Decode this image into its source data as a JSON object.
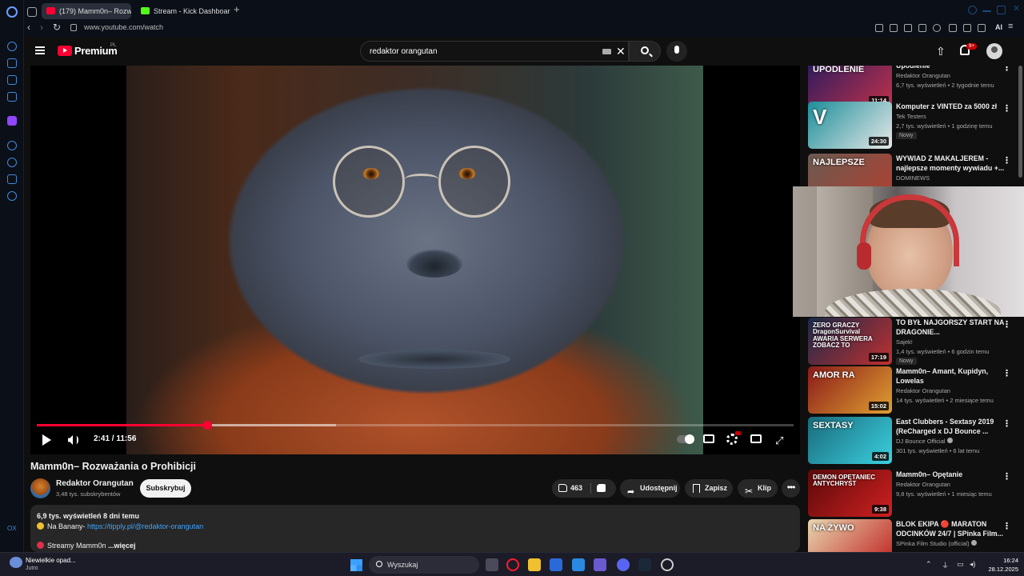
{
  "browser": {
    "tabs": [
      {
        "label": "(179) Mamm0n– Rozważani",
        "active": true
      },
      {
        "label": "Stream - Kick Dashboard",
        "active": false
      }
    ],
    "url": "www.youtube.com/watch",
    "ai_label": "AI"
  },
  "header": {
    "logo_text": "Premium",
    "region": "PL",
    "search_value": "redaktor orangutan",
    "notifications_badge": "9+"
  },
  "player": {
    "time_display": "2:41 / 11:56",
    "progress_fraction": 0.225,
    "buffer_fraction": 0.395
  },
  "video": {
    "title": "Mamm0n– Rozważania o Prohibicji",
    "channel_name": "Redaktor Orangutan",
    "subscribers": "3,48 tys. subskrybentów",
    "subscribe_label": "Subskrybuj",
    "likes": "463",
    "share_label": "Udostępnij",
    "save_label": "Zapisz",
    "clip_label": "Klip",
    "more_label": "•••"
  },
  "description": {
    "meta": "6,9 tys. wyświetleń  8 dni temu",
    "line1_prefix": "Na Banany- ",
    "line1_link": "https://tipply.pl/@redaktor-orangutan",
    "line2_prefix": "Streamy Mamm0n",
    "line2_more": " ...więcej"
  },
  "related": [
    {
      "title": "Upodlenie",
      "channel": "Redaktor Orangutan",
      "meta": "6,7 tys. wyświetleń • 2 tygodnie temu",
      "duration": "11:14",
      "badge": "",
      "thumb_text": "UPODLENIE",
      "color1": "#2d1b5e",
      "color2": "#c0314a"
    },
    {
      "title": "Komputer z VINTED za 5000 zł",
      "channel": "Tek Testers",
      "meta": "2,7 tys. wyświetleń • 1 godzinę temu",
      "duration": "24:30",
      "badge": "Nowy",
      "thumb_text": "V",
      "color1": "#1c8f9a",
      "color2": "#e8e8e8"
    },
    {
      "title": "WYWIAD Z MAKALJEREM - najlepsze momenty wywiadu +...",
      "channel": "DOMINEWS",
      "meta": "",
      "duration": "",
      "badge": "",
      "thumb_text": "NAJLEPSZE",
      "color1": "#6a5a52",
      "color2": "#b04030"
    },
    {
      "title": "TO BYŁ NAJGORSZY START NA DRAGONIE...",
      "channel": "Sajek!",
      "meta": "1,4 tys. wyświetleń • 6 godzin temu",
      "duration": "17:19",
      "badge": "Nowy",
      "thumb_text": "ZERO GRACZY DragonSurvival AWARIA SERWERA ZOBACZ TO",
      "color1": "#1a2a4a",
      "color2": "#c03030"
    },
    {
      "title": "Mamm0n– Amant, Kupidyn, Lowelas",
      "channel": "Redaktor Orangutan",
      "meta": "14 tys. wyświetleń • 2 miesiące temu",
      "duration": "15:02",
      "badge": "",
      "thumb_text": "AMOR RA",
      "color1": "#8a1a1a",
      "color2": "#e0a030"
    },
    {
      "title": "East Clubbers - Sextasy 2019 (ReCharged x DJ Bounce ...",
      "channel": "DJ Bounce Official",
      "meta": "301 tys. wyświetleń • 6 lat temu",
      "duration": "4:02",
      "badge": "",
      "thumb_text": "SEXTASY",
      "color1": "#1a6a7a",
      "color2": "#3ad0e0"
    },
    {
      "title": "Mamm0n– Opętanie",
      "channel": "Redaktor Orangutan",
      "meta": "9,8 tys. wyświetleń • 1 miesiąc temu",
      "duration": "9:38",
      "badge": "",
      "thumb_text": "DEMON OPĘTANIEC ANTYCHRYST",
      "color1": "#5a0a0a",
      "color2": "#d02020"
    },
    {
      "title": "BLOK EKIPA 🔴 MARATON ODCINKÓW 24/7 | SPinka Film...",
      "channel": "SPinka Film Studio (official)",
      "meta": "",
      "duration": "",
      "badge": "",
      "thumb_text": "NA ŻYWO",
      "color1": "#e8d8b0",
      "color2": "#c02020"
    }
  ],
  "taskbar": {
    "weather_title": "Niewielkie opad...",
    "weather_sub": "Jutro",
    "search_placeholder": "Wyszukaj",
    "time": "16:24",
    "date": "28.12.2025"
  }
}
